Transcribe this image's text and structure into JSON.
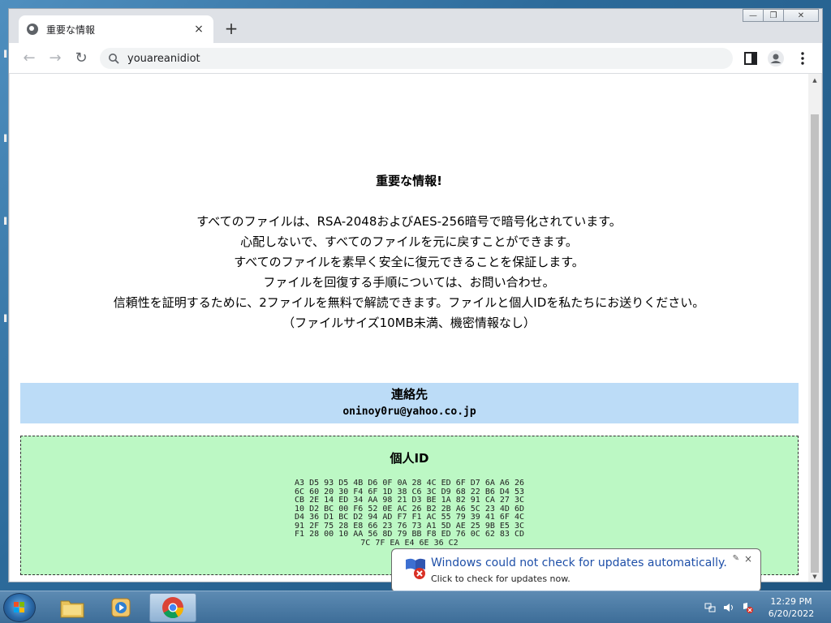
{
  "browser": {
    "tab_title": "重要な情報",
    "tab_close": "×",
    "new_tab": "+",
    "address": "youareanidiot",
    "back": "←",
    "forward": "→",
    "reload": "↻",
    "caption": {
      "minimize": "—",
      "restore": "❐",
      "close": "✕"
    }
  },
  "page": {
    "title": "重要な情報!",
    "lines": [
      "すべてのファイルは、RSA-2048およびAES-256暗号で暗号化されています。",
      "心配しないで、すべてのファイルを元に戻すことができます。",
      "すべてのファイルを素早く安全に復元できることを保証します。",
      "ファイルを回復する手順については、お問い合わせ。",
      "信頼性を証明するために、2ファイルを無料で解読できます。ファイルと個人IDを私たちにお送りください。",
      "（ファイルサイズ10MB未満、機密情報なし）"
    ],
    "contact_heading": "連絡先",
    "contact_email": "oninoy0ru@yahoo.co.jp",
    "id_heading": "個人ID",
    "id_lines": [
      "A3 D5 93 D5 4B D6 0F 0A 28 4C ED 6F D7 6A A6 26",
      "6C 60 20 30 F4 6F 1D 38 C6 3C D9 68 22 B6 D4 53",
      "CB 2E 14 ED 34 AA 98 21 D3 BE 1A 82 91 CA 27 3C",
      "10 D2 BC 00 F6 52 0E AC 26 B2 2B A6 5C 23 4D 6D",
      "D4 36 D1 BC D2 94 AD F7 F1 AC 55 79 39 41 6F 4C",
      "91 2F 75 28 E8 66 23 76 73 A1 5D AE 25 9B E5 3C",
      "F1 28 00 10 AA 56 8D 79 BB F8 ED 76 0C 62 83 CD",
      "7C 7F EA E4 6E 36 C2"
    ]
  },
  "notification": {
    "title": "Windows could not check for updates automatically.",
    "body": "Click to check for updates now.",
    "close": "×"
  },
  "taskbar": {
    "time": "12:29 PM",
    "date": "6/20/2022"
  },
  "colors": {
    "contact_bg": "#bcdcf7",
    "id_bg": "#bcf8c4",
    "notification_title": "#1e4fa8"
  }
}
